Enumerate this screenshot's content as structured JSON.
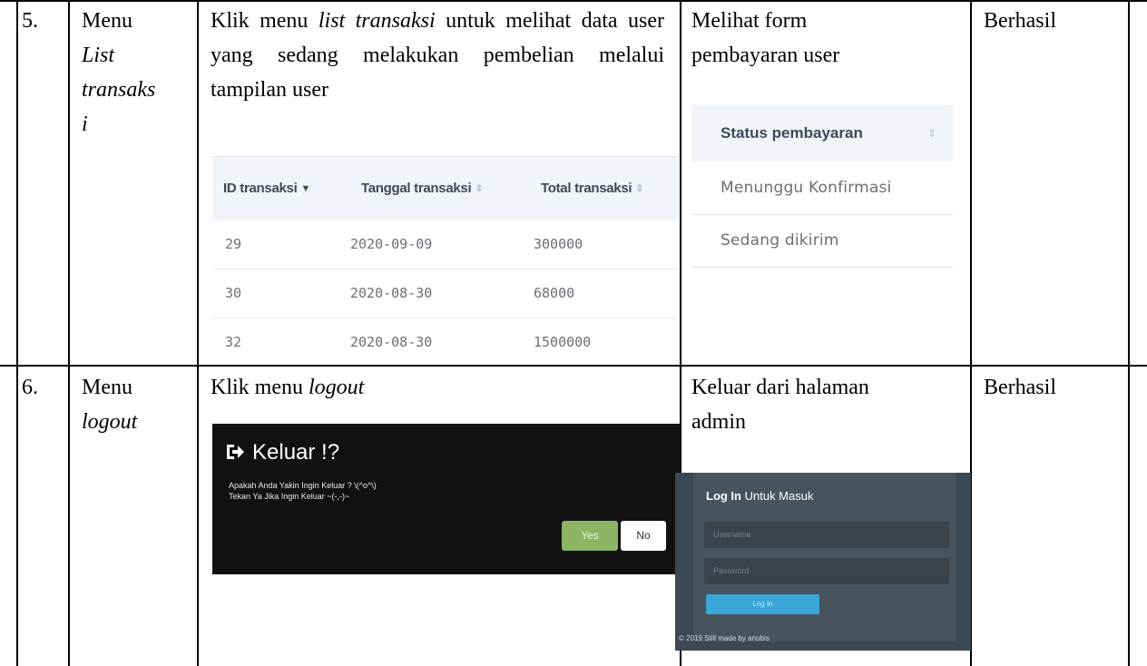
{
  "rows": [
    {
      "number": "5.",
      "menu_line1": "Menu",
      "menu_line2": "List",
      "menu_line3": "transaks",
      "menu_line4": "i",
      "step_prefix": "Klik menu ",
      "step_italic": "list transaksi",
      "step_suffix": " untuk melihat data user yang sedang melakukan pembelian melalui tampilan user",
      "expected_line1": "Melihat form",
      "expected_line2": "pembayaran user",
      "result": "Berhasil",
      "transaction_table": {
        "headers": [
          "ID transaksi",
          "Tanggal transaksi",
          "Total transaksi"
        ],
        "rows": [
          [
            "29",
            "2020-09-09",
            "300000"
          ],
          [
            "30",
            "2020-08-30",
            "68000"
          ],
          [
            "32",
            "2020-08-30",
            "1500000"
          ]
        ]
      },
      "status_table": {
        "header": "Status pembayaran",
        "rows": [
          "Menunggu Konfirmasi",
          "Sedang dikirim"
        ]
      }
    },
    {
      "number": "6.",
      "menu_line1": "Menu",
      "menu_line2": "logout",
      "step_prefix": "Klik menu ",
      "step_italic": "logout",
      "expected_line1": "Keluar dari halaman",
      "expected_line2": "admin",
      "result": "Berhasil",
      "logout_dialog": {
        "title": "Keluar !?",
        "message_line1": "Apakah Anda Yakin Ingin Keluar ? \\(^o^\\)",
        "message_line2": "Tekan Ya Jika Ingin Keluar ~(-,-)~",
        "yes_label": "Yes",
        "no_label": "No"
      },
      "login_form": {
        "title_bold": "Log In",
        "title_rest": " Untuk Masuk",
        "username_placeholder": "Username",
        "password_placeholder": "Password",
        "login_button": "Log In",
        "footer": "© 2019 Still made by anubis"
      }
    }
  ],
  "colors": {
    "table_header_bg": "#f1f4f8",
    "dialog_bg": "#111111",
    "yes_button": "#8cb462",
    "login_bg": "#47535e",
    "login_button": "#3aa7d6"
  }
}
